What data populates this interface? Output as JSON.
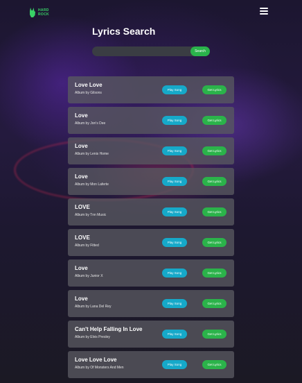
{
  "header": {
    "logo_text_line1": "HARD",
    "logo_text_line2": "ROCK",
    "menu_icon": "hamburger-menu-icon"
  },
  "title": "Lyrics Search",
  "search": {
    "value": "",
    "placeholder": "",
    "button_label": "Search"
  },
  "colors": {
    "accent_green": "#2bb34a",
    "accent_blue": "#16a9c9",
    "card_bg": "#585860"
  },
  "results": [
    {
      "title": "Love Love",
      "album": "Album by Gilsons",
      "play_label": "Play Song",
      "lyrics_label": "Get Lyrics"
    },
    {
      "title": "Love",
      "album": "Album by Jon's Dee",
      "play_label": "Play Song",
      "lyrics_label": "Get Lyrics"
    },
    {
      "title": "Love",
      "album": "Album by Lenis Home",
      "play_label": "Play Song",
      "lyrics_label": "Get Lyrics"
    },
    {
      "title": "Love",
      "album": "Album by Mon Laferte",
      "play_label": "Play Song",
      "lyrics_label": "Get Lyrics"
    },
    {
      "title": "LOVE",
      "album": "Album by Tnn Music",
      "play_label": "Play Song",
      "lyrics_label": "Get Lyrics"
    },
    {
      "title": "LOVE",
      "album": "Album by Fitted",
      "play_label": "Play Song",
      "lyrics_label": "Get Lyrics"
    },
    {
      "title": "Love",
      "album": "Album by Junior X",
      "play_label": "Play Song",
      "lyrics_label": "Get Lyrics"
    },
    {
      "title": "Love",
      "album": "Album by Lana Del Rey",
      "play_label": "Play Song",
      "lyrics_label": "Get Lyrics"
    },
    {
      "title": "Can't Help Falling In Love",
      "album": "Album by Elvis Presley",
      "play_label": "Play Song",
      "lyrics_label": "Get Lyrics"
    },
    {
      "title": "Love Love Love",
      "album": "Album by Of Monsters And Men",
      "play_label": "Play Song",
      "lyrics_label": "Get Lyrics"
    }
  ]
}
